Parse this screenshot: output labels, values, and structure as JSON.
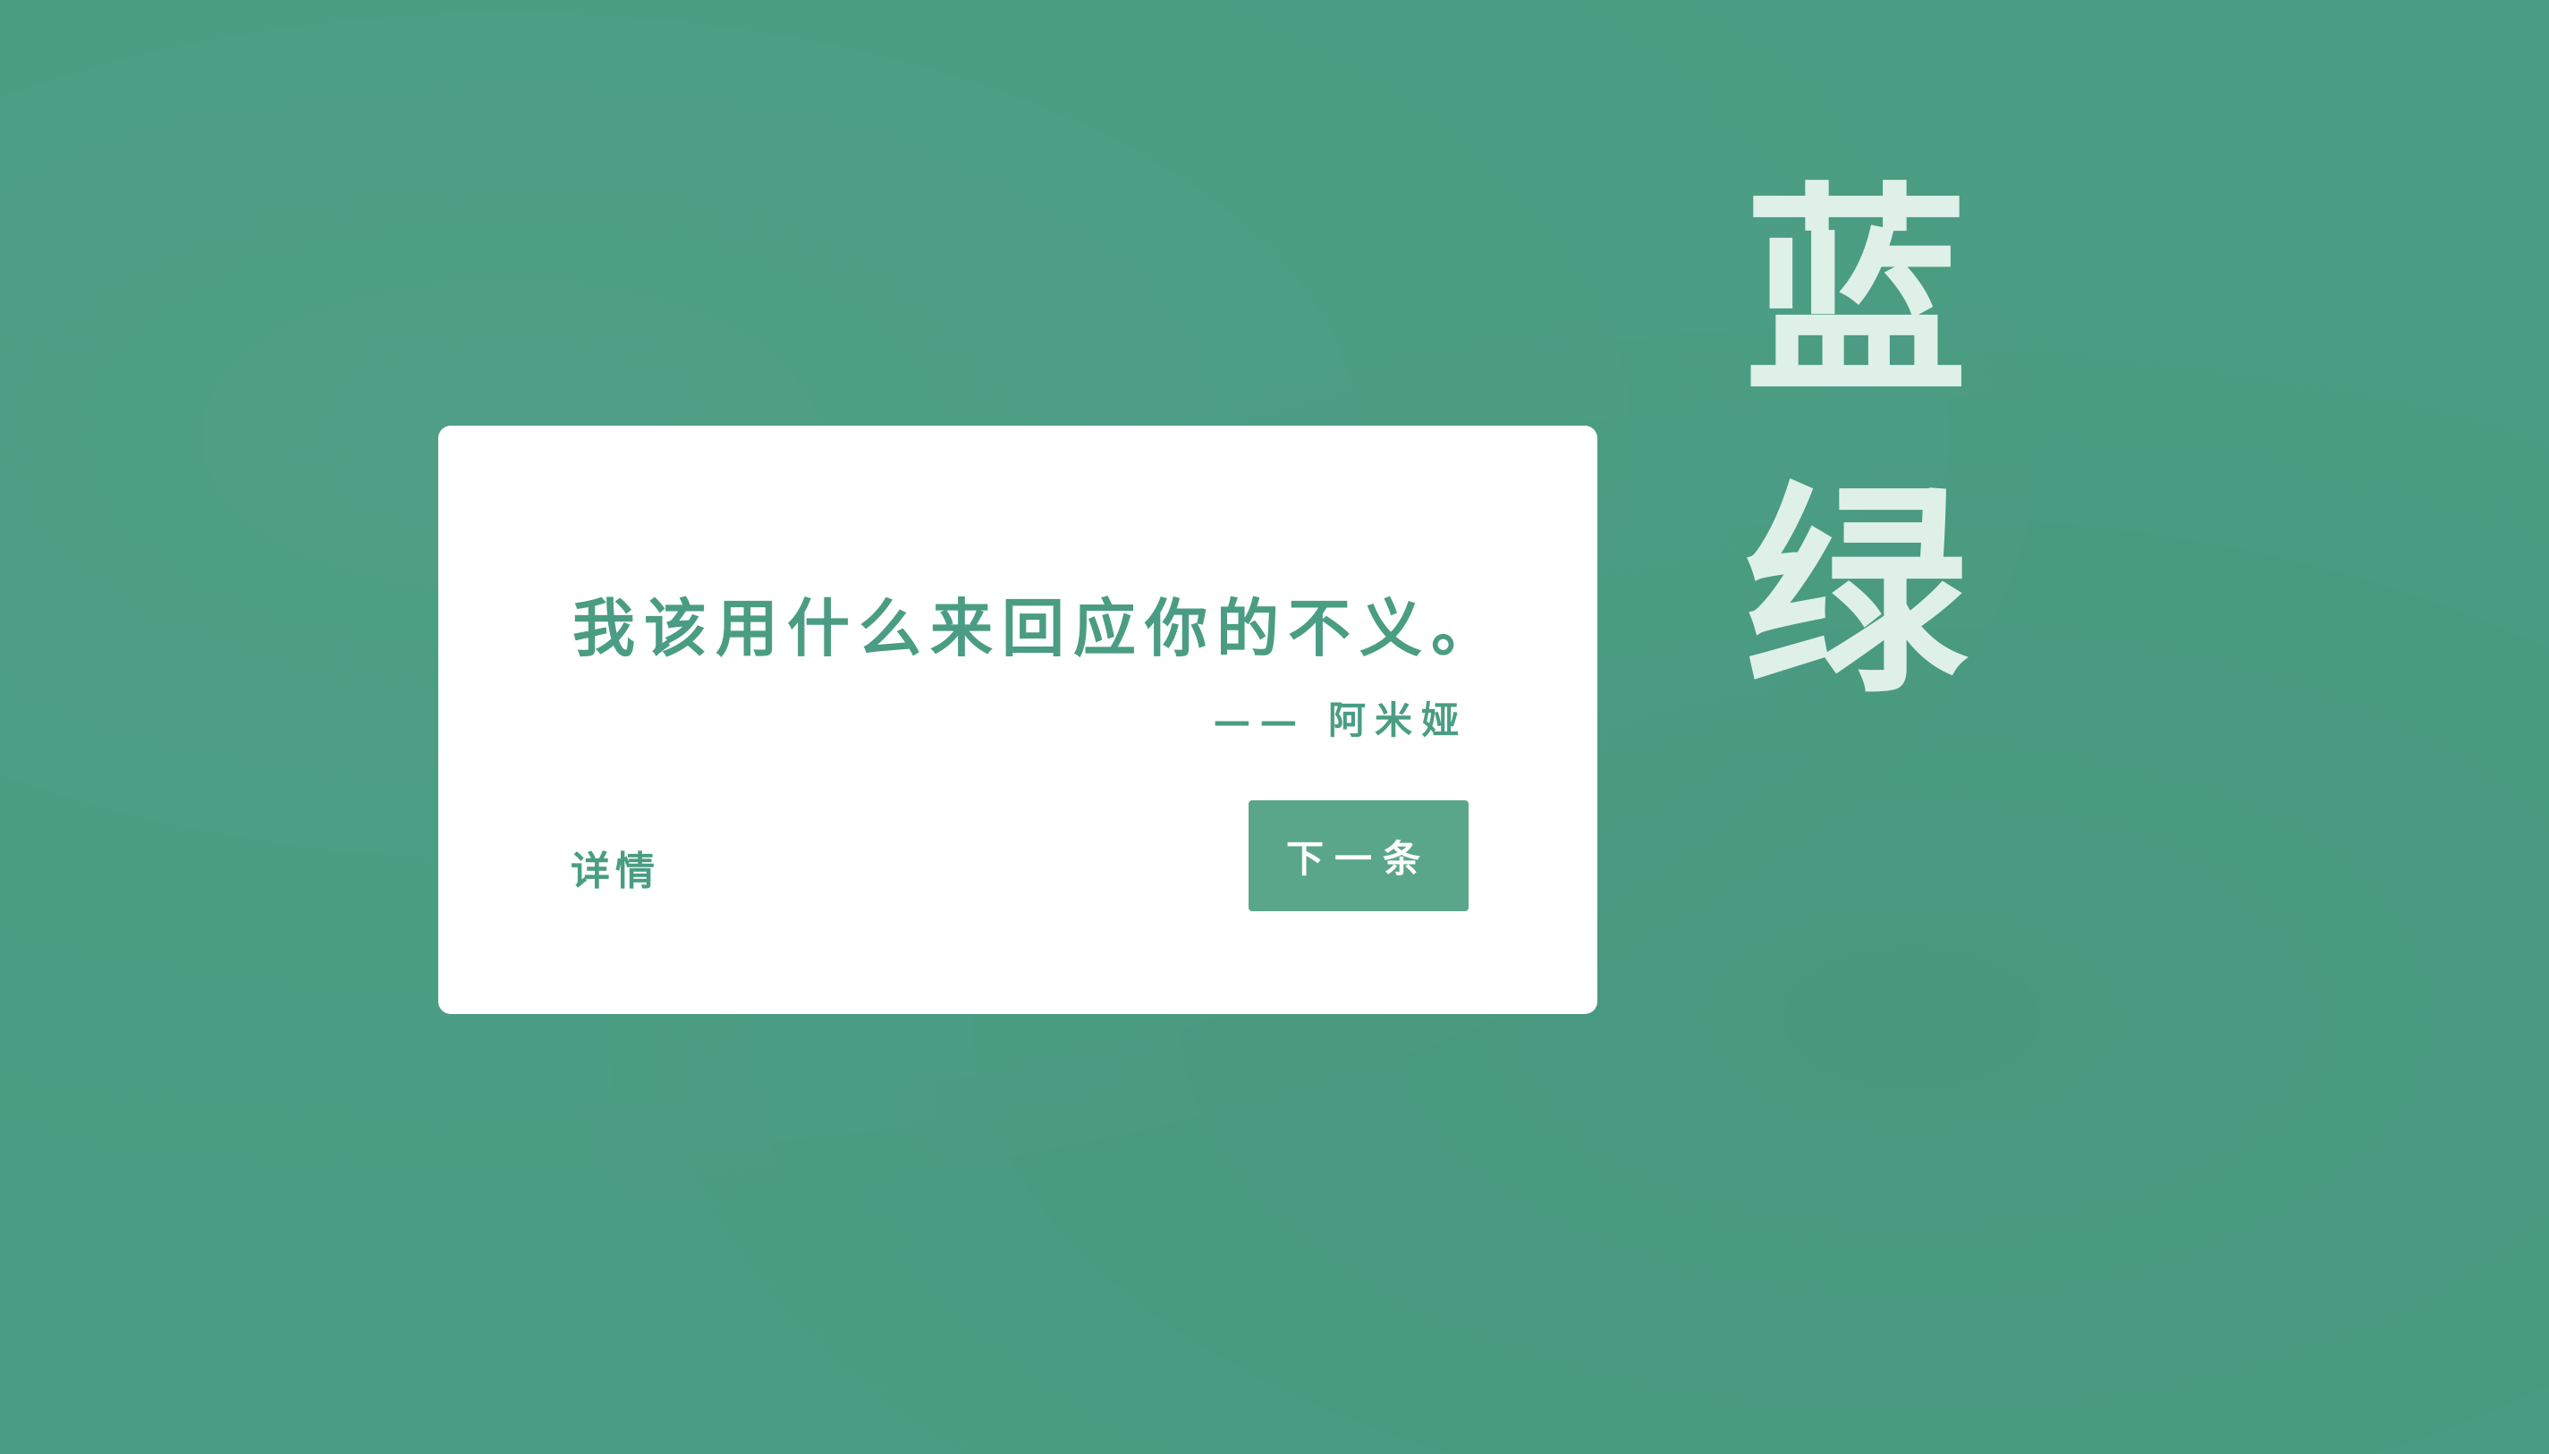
{
  "color_name": {
    "chars": [
      "蓝",
      "绿"
    ]
  },
  "card": {
    "quote": "我该用什么来回应你的不义。",
    "author": "—— 阿米娅",
    "details_label": "详情",
    "next_label": "下一条"
  },
  "colors": {
    "background": "#4a9d82",
    "accent": "#4a9d82",
    "button": "#5aa68a",
    "title_text": "#dff0e9",
    "card": "#ffffff"
  }
}
